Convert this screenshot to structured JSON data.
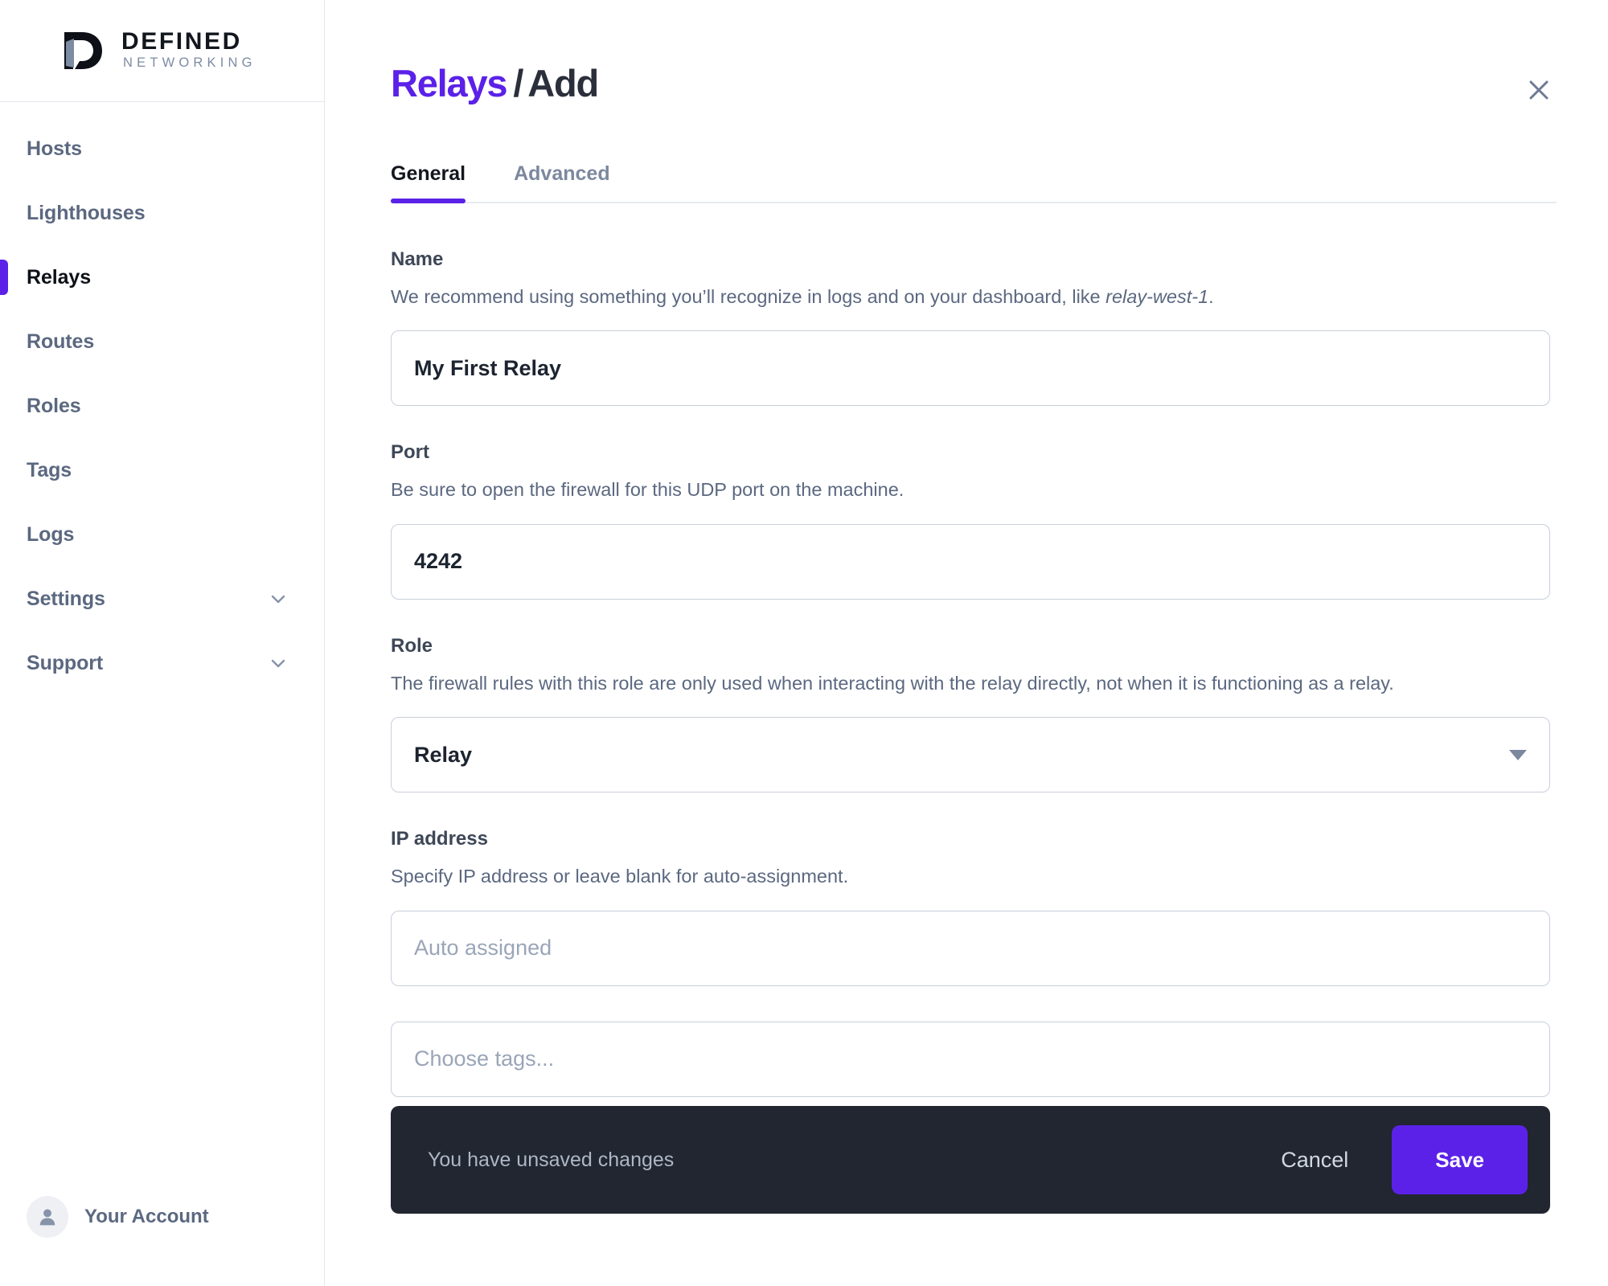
{
  "sidebar": {
    "logo": {
      "icon": "defined-networking-logo",
      "line1": "DEFINED",
      "line2": "NETWORKING"
    },
    "items": [
      {
        "label": "Hosts",
        "active": false,
        "expandable": false,
        "icon": ""
      },
      {
        "label": "Lighthouses",
        "active": false,
        "expandable": false,
        "icon": ""
      },
      {
        "label": "Relays",
        "active": true,
        "expandable": false,
        "icon": ""
      },
      {
        "label": "Routes",
        "active": false,
        "expandable": false,
        "icon": ""
      },
      {
        "label": "Roles",
        "active": false,
        "expandable": false,
        "icon": ""
      },
      {
        "label": "Tags",
        "active": false,
        "expandable": false,
        "icon": ""
      },
      {
        "label": "Logs",
        "active": false,
        "expandable": false,
        "icon": ""
      },
      {
        "label": "Settings",
        "active": false,
        "expandable": true,
        "icon": "chevron-down-icon"
      },
      {
        "label": "Support",
        "active": false,
        "expandable": true,
        "icon": "chevron-down-icon"
      }
    ],
    "account": {
      "label": "Your Account",
      "avatar_icon": "user-avatar-icon"
    }
  },
  "header": {
    "title_primary": "Relays",
    "title_separator": "/",
    "title_secondary": "Add",
    "close_icon": "close-icon"
  },
  "tabs": [
    {
      "label": "General",
      "active": true
    },
    {
      "label": "Advanced",
      "active": false
    }
  ],
  "form": {
    "name": {
      "label": "Name",
      "help_before": "We recommend using something you’ll recognize in logs and on your dashboard, like ",
      "help_em": "relay-west-1",
      "help_after": ".",
      "value": "My First Relay"
    },
    "port": {
      "label": "Port",
      "help": "Be sure to open the firewall for this UDP port on the machine.",
      "value": "4242"
    },
    "role": {
      "label": "Role",
      "help": "The firewall rules with this role are only used when interacting with the relay directly, not when it is functioning as a relay.",
      "value": "Relay",
      "caret_icon": "chevron-down-icon"
    },
    "ip_address": {
      "label": "IP address",
      "help": "Specify IP address or leave blank for auto-assignment.",
      "placeholder": "Auto assigned",
      "value": ""
    },
    "tags": {
      "placeholder": "Choose tags...",
      "value": ""
    }
  },
  "unsaved_bar": {
    "message": "You have unsaved changes",
    "cancel_label": "Cancel",
    "save_label": "Save"
  },
  "colors": {
    "accent": "#5b21e8",
    "dark_bar": "#212630",
    "text_muted": "#5b6880",
    "border": "#c8cfdb"
  }
}
